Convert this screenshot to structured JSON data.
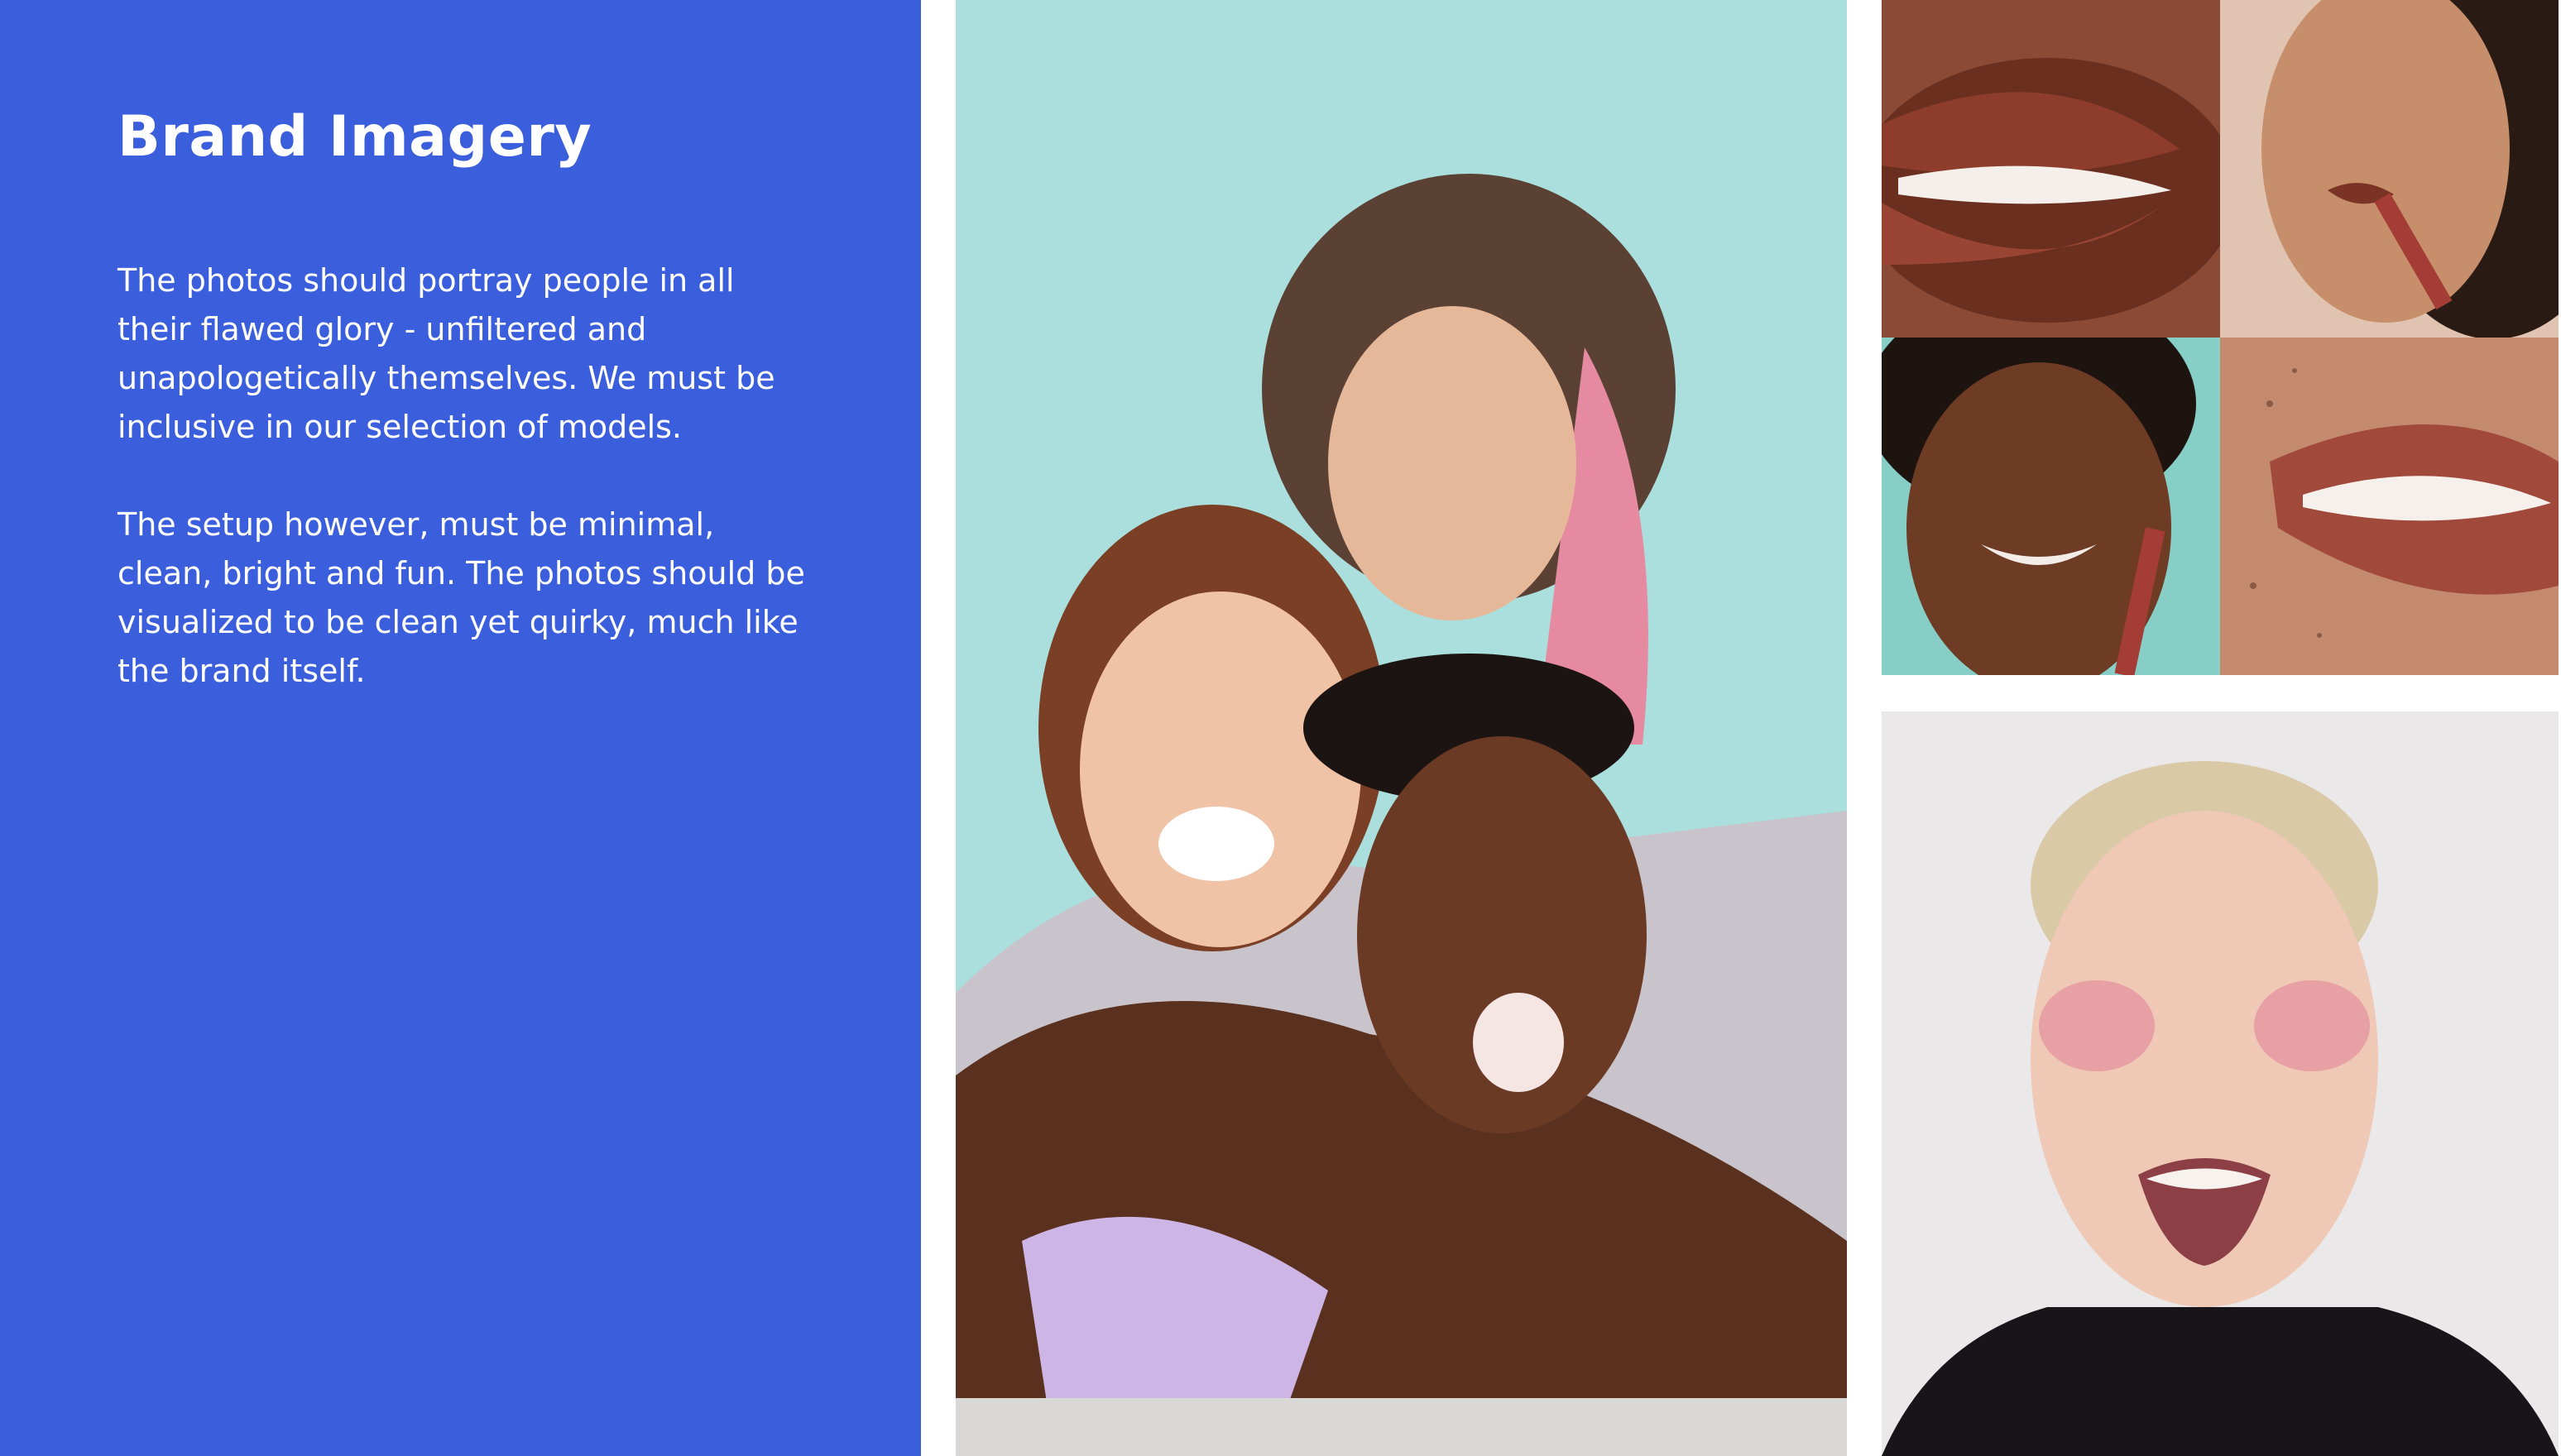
{
  "slide": {
    "title": "Brand Imagery",
    "paragraphs": [
      "The photos should portray people in all their flawed glory  - unfiltered and unapologetically themselves. We must be inclusive in our selection of models.",
      "The setup however, must be minimal, clean, bright and fun. The photos should be visualized to be clean yet quirky, much like the brand itself."
    ]
  },
  "colors": {
    "panel": "#3b5fdc",
    "text": "#ffffff",
    "background": "#ffffff"
  }
}
